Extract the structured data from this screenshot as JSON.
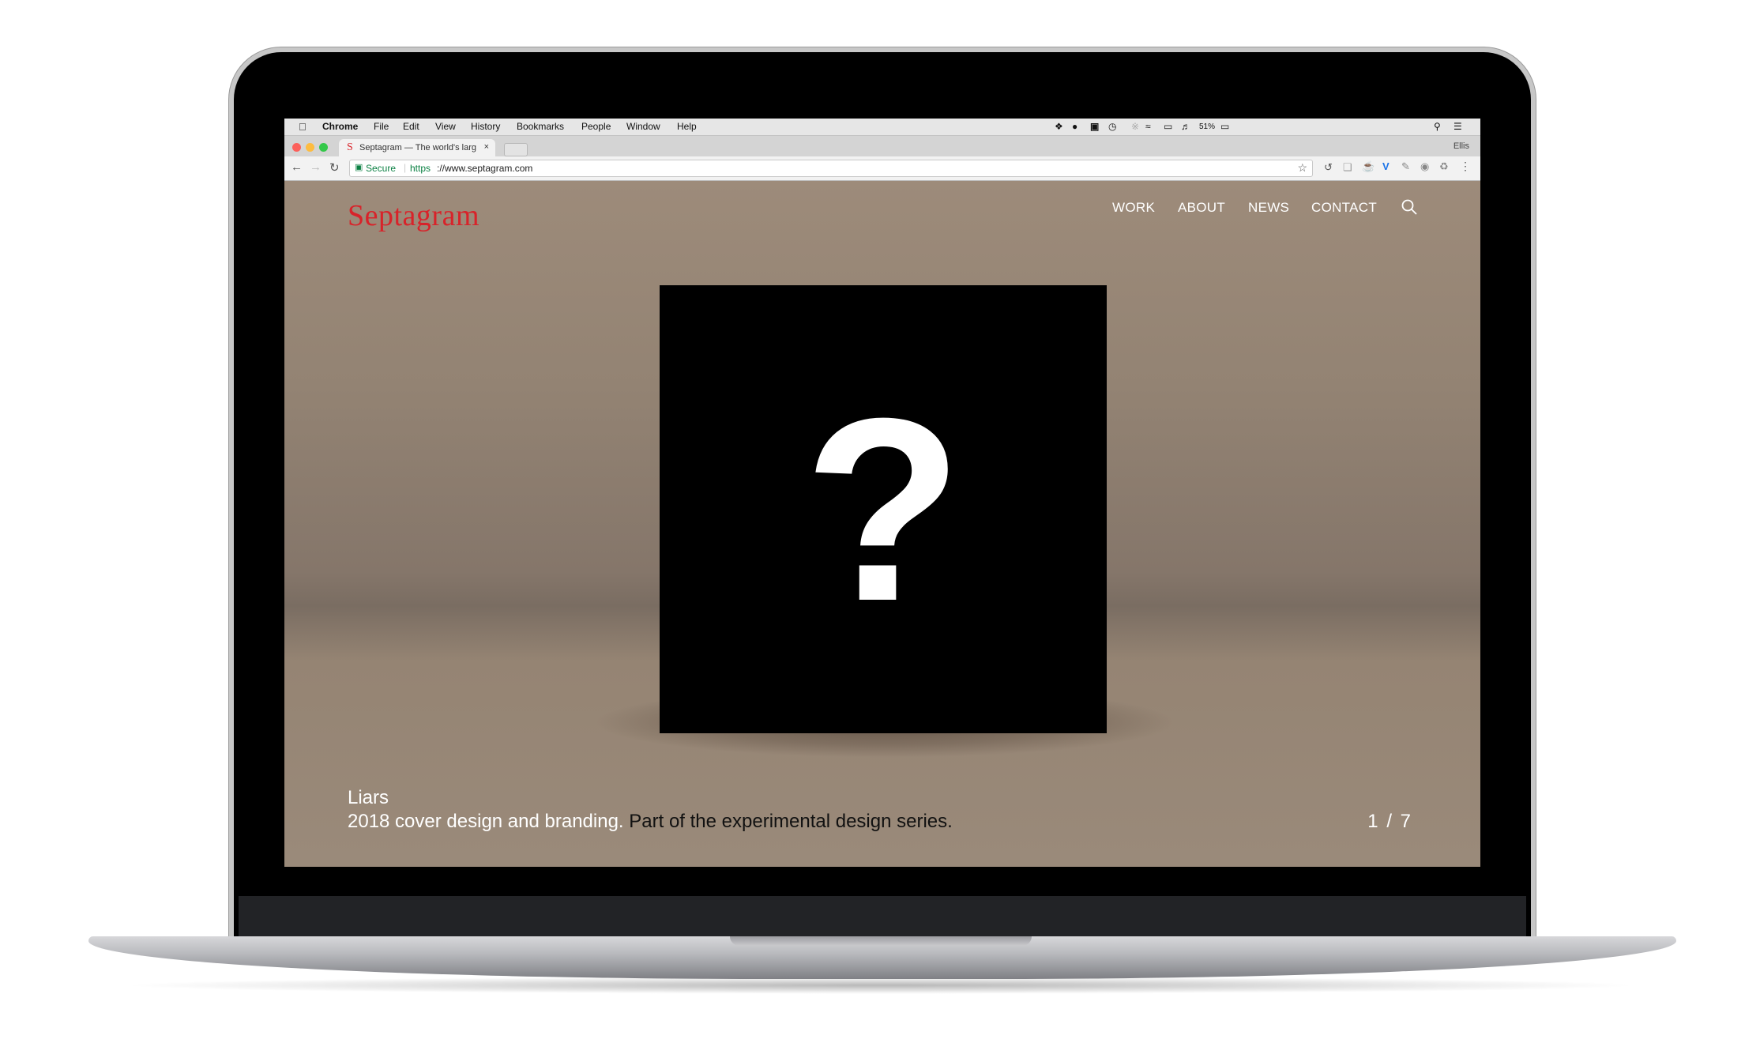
{
  "menubar": {
    "app": "Chrome",
    "items": [
      "File",
      "Edit",
      "View",
      "History",
      "Bookmarks",
      "People",
      "Window",
      "Help"
    ],
    "battery": "51%"
  },
  "browser": {
    "tab_title": "Septagram — The world's larg",
    "tab_favicon": "S",
    "profile": "Ellis",
    "secure_label": "Secure",
    "url_scheme": "https",
    "url_rest": "://www.septagram.com"
  },
  "site": {
    "logo": "Septagram",
    "brand_color": "#d8232a",
    "nav": [
      "WORK",
      "ABOUT",
      "NEWS",
      "CONTACT"
    ],
    "slide": {
      "title": "Liars",
      "description_part1": "2018 cover design and branding.",
      "description_part2": "Part of the experimental design series.",
      "counter": "1  /  7",
      "cover_glyph": "?"
    }
  }
}
